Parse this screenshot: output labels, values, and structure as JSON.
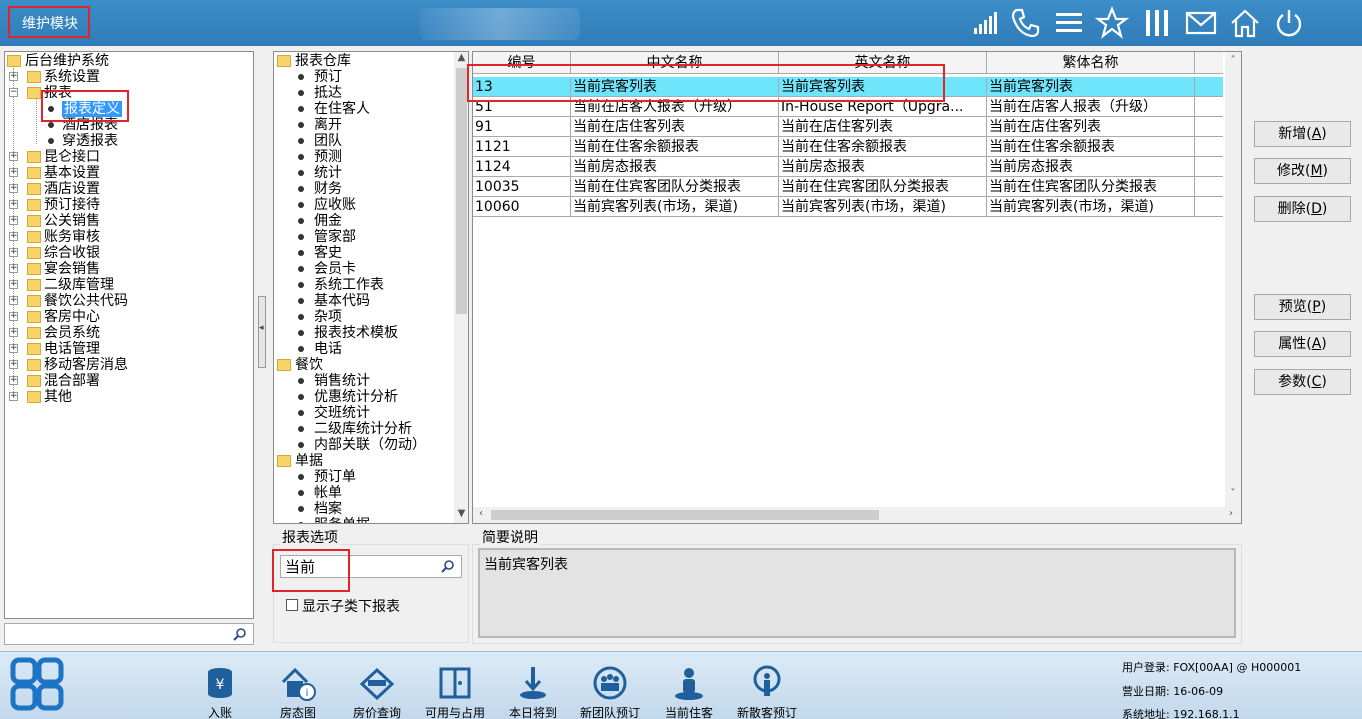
{
  "header": {
    "module_title": "维护模块"
  },
  "tree": {
    "root": "后台维护系统",
    "items": [
      {
        "label": "系统设置",
        "type": "folder-collapsed"
      },
      {
        "label": "报表",
        "type": "folder-expanded"
      },
      {
        "label": "报表定义",
        "type": "leaf",
        "selected": true
      },
      {
        "label": "酒店报表",
        "type": "leaf"
      },
      {
        "label": "穿透报表",
        "type": "leaf"
      },
      {
        "label": "昆仑接口",
        "type": "folder-collapsed"
      },
      {
        "label": "基本设置",
        "type": "folder-collapsed"
      },
      {
        "label": "酒店设置",
        "type": "folder-collapsed"
      },
      {
        "label": "预订接待",
        "type": "folder-collapsed"
      },
      {
        "label": "公关销售",
        "type": "folder-collapsed"
      },
      {
        "label": "账务审核",
        "type": "folder-collapsed"
      },
      {
        "label": "综合收银",
        "type": "folder-collapsed"
      },
      {
        "label": "宴会销售",
        "type": "folder-collapsed"
      },
      {
        "label": "二级库管理",
        "type": "folder-collapsed"
      },
      {
        "label": "餐饮公共代码",
        "type": "folder-collapsed"
      },
      {
        "label": "客房中心",
        "type": "folder-collapsed"
      },
      {
        "label": "会员系统",
        "type": "folder-collapsed"
      },
      {
        "label": "电话管理",
        "type": "folder-collapsed"
      },
      {
        "label": "移动客房消息",
        "type": "folder-collapsed"
      },
      {
        "label": "混合部署",
        "type": "folder-collapsed"
      },
      {
        "label": "其他",
        "type": "folder-collapsed"
      }
    ]
  },
  "categories": [
    {
      "label": "报表仓库",
      "type": "folder"
    },
    {
      "label": "预订",
      "type": "leaf"
    },
    {
      "label": "抵达",
      "type": "leaf"
    },
    {
      "label": "在住客人",
      "type": "leaf"
    },
    {
      "label": "离开",
      "type": "leaf"
    },
    {
      "label": "团队",
      "type": "leaf"
    },
    {
      "label": "预测",
      "type": "leaf"
    },
    {
      "label": "统计",
      "type": "leaf"
    },
    {
      "label": "财务",
      "type": "leaf"
    },
    {
      "label": "应收账",
      "type": "leaf"
    },
    {
      "label": "佣金",
      "type": "leaf"
    },
    {
      "label": "管家部",
      "type": "leaf"
    },
    {
      "label": "客史",
      "type": "leaf"
    },
    {
      "label": "会员卡",
      "type": "leaf"
    },
    {
      "label": "系统工作表",
      "type": "leaf"
    },
    {
      "label": "基本代码",
      "type": "leaf"
    },
    {
      "label": "杂项",
      "type": "leaf"
    },
    {
      "label": "报表技术模板",
      "type": "leaf"
    },
    {
      "label": "电话",
      "type": "leaf"
    },
    {
      "label": "餐饮",
      "type": "folder"
    },
    {
      "label": "销售统计",
      "type": "leaf"
    },
    {
      "label": "优惠统计分析",
      "type": "leaf"
    },
    {
      "label": "交班统计",
      "type": "leaf"
    },
    {
      "label": "二级库统计分析",
      "type": "leaf"
    },
    {
      "label": "内部关联（勿动）",
      "type": "leaf"
    },
    {
      "label": "单据",
      "type": "folder"
    },
    {
      "label": "预订单",
      "type": "leaf"
    },
    {
      "label": "帐单",
      "type": "leaf"
    },
    {
      "label": "档案",
      "type": "leaf"
    },
    {
      "label": "服务单据",
      "type": "leaf"
    }
  ],
  "grid": {
    "columns": [
      "编号",
      "中文名称",
      "英文名称",
      "繁体名称"
    ],
    "rows": [
      [
        "13",
        "当前宾客列表",
        "当前宾客列表",
        "当前宾客列表"
      ],
      [
        "51",
        "当前在店客人报表（升级）",
        "In-House Report（Upgra...",
        "当前在店客人报表（升级）"
      ],
      [
        "91",
        "当前在店住客列表",
        "当前在店住客列表",
        "当前在店住客列表"
      ],
      [
        "1121",
        "当前在住客余额报表",
        "当前在住客余额报表",
        "当前在住客余额报表"
      ],
      [
        "1124",
        "当前房态报表",
        "当前房态报表",
        "当前房态报表"
      ],
      [
        "10035",
        "当前在住宾客团队分类报表",
        "当前在住宾客团队分类报表",
        "当前在住宾客团队分类报表"
      ],
      [
        "10060",
        "当前宾客列表(市场，渠道)",
        "当前宾客列表(市场，渠道)",
        "当前宾客列表(市场，渠道)"
      ]
    ]
  },
  "buttons": {
    "add": {
      "label": "新增(",
      "key": "A",
      "end": ")"
    },
    "edit": {
      "label": "修改(",
      "key": "M",
      "end": ")"
    },
    "delete": {
      "label": "删除(",
      "key": "D",
      "end": ")"
    },
    "preview": {
      "label": "预览(",
      "key": "P",
      "end": ")"
    },
    "properties": {
      "label": "属性(",
      "key": "A",
      "end": ")"
    },
    "params": {
      "label": "参数(",
      "key": "C",
      "end": ")"
    }
  },
  "options": {
    "group_label": "报表选项",
    "search_value": "当前",
    "show_sub_label": "显示子类下报表"
  },
  "description": {
    "group_label": "简要说明",
    "text": "当前宾客列表"
  },
  "bottom_toolbar": [
    {
      "label": "入账",
      "icon": "yen-coins-icon"
    },
    {
      "label": "房态图",
      "icon": "house-info-icon"
    },
    {
      "label": "房价查询",
      "icon": "price-query-icon"
    },
    {
      "label": "可用与占用",
      "icon": "door-icon"
    },
    {
      "label": "本日将到",
      "icon": "arrival-icon"
    },
    {
      "label": "新团队预订",
      "icon": "group-booking-icon"
    },
    {
      "label": "当前住客",
      "icon": "guest-icon"
    },
    {
      "label": "新散客预订",
      "icon": "walkin-booking-icon"
    }
  ],
  "status": {
    "user": "用户登录: FOX[00AA] @ H000001",
    "business_date": "营业日期: 16-06-09",
    "system_address": "系统地址: 192.168.1.1"
  },
  "colors": {
    "topbar": "#3083c0",
    "selected_row": "#6ee5fb",
    "highlight_border": "#e0242b",
    "tree_selected": "#3399ff"
  }
}
